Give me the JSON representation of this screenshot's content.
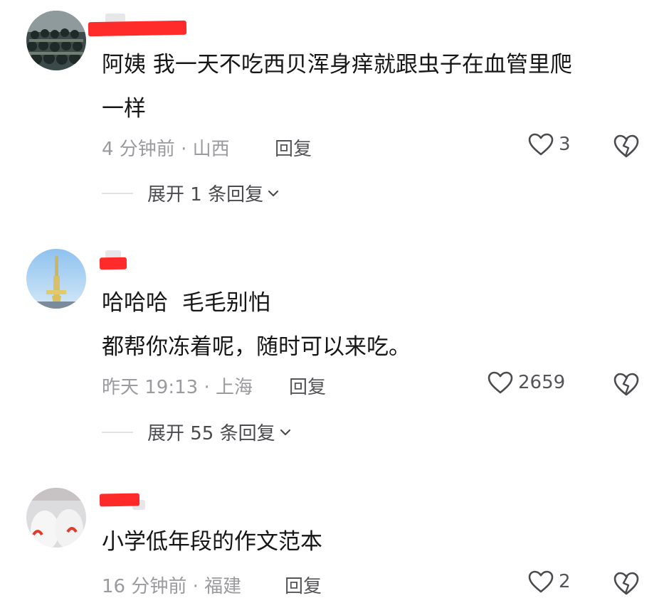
{
  "comments": [
    {
      "text_lines": [
        "阿姨 我一天不吃西贝浑身痒就跟虫子在血管里爬",
        "一样"
      ],
      "time_location": "4 分钟前 · 山西",
      "reply_label": "回复",
      "likes": "3",
      "expand_label": "展开 1 条回复"
    },
    {
      "text_lines": [
        "哈哈哈  毛毛别怕",
        "都帮你冻着呢，随时可以来吃。"
      ],
      "time_location": "昨天 19:13 · 上海",
      "reply_label": "回复",
      "likes": "2659",
      "expand_label": "展开 55 条回复"
    },
    {
      "text_lines": [
        "小学低年段的作文范本"
      ],
      "time_location": "16 分钟前 · 福建",
      "reply_label": "回复",
      "likes": "2"
    }
  ],
  "icons": {
    "like": "heart-outline-icon",
    "dislike": "broken-heart-icon",
    "expand": "chevron-down-icon"
  },
  "colors": {
    "text": "#161616",
    "meta": "#9a9a9f",
    "redaction": "#ff2a2a"
  }
}
